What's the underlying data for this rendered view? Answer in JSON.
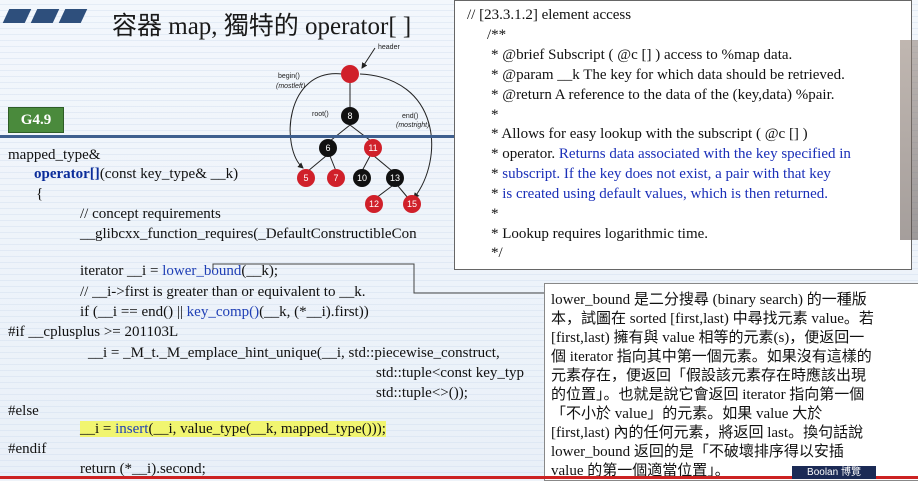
{
  "title": "容器 map, 獨特的 operator[ ]",
  "version_tag": "G4.9",
  "tree": {
    "header_label": "header",
    "begin_label": "begin()",
    "begin_sub": "(mostleft)",
    "root_label": "root()",
    "end_label": "end()",
    "end_sub": "(mostright)",
    "nodes": [
      "8",
      "6",
      "11",
      "5",
      "7",
      "10",
      "13",
      "12",
      "15"
    ]
  },
  "code": {
    "l1": "mapped_type&",
    "l2a": "operator[]",
    "l2b": "(const key_type& __k)",
    "l3": "{",
    "l4": "// concept requirements",
    "l5": "__glibcxx_function_requires(_DefaultConstructibleCon",
    "l6a": "iterator __i = ",
    "l6b": "lower_bound",
    "l6c": "(__k);",
    "l7": "// __i->first is greater than or equivalent to __k.",
    "l8a": "if (__i == end() || ",
    "l8b": "key_comp()",
    "l8c": "(__k, (*__i).first))",
    "l9": "#if __cplusplus >= 201103L",
    "l10": "__i = _M_t._M_emplace_hint_unique(__i, std::piecewise_construct,",
    "l11": "std::tuple<const key_typ",
    "l12": "std::tuple<>());",
    "l13": "#else",
    "l14a": "__i = ",
    "l14b": "insert",
    "l14c": "(__i, value_type(__k, mapped_type()));",
    "l15": "#endif",
    "l16": "return (*__i).second;"
  },
  "doc": {
    "d1": "// [23.3.1.2] element access",
    "d2": "/**",
    "d3": "*  @brief  Subscript ( @c [] ) access to %map data.",
    "d4": "*  @param  __k  The key for which data should be retrieved.",
    "d5": "*  @return  A reference to the data of the (key,data) %pair.",
    "d6": "*",
    "d7": "*  Allows for easy lookup with the subscript ( @c [] )",
    "d8a": "*  operator.  ",
    "d8b": "Returns data associated with the key specified in",
    "d9a": "*  ",
    "d9b": "subscript.  If the key does not exist, a pair with that key",
    "d10a": "*  ",
    "d10b": "is created using default values, which is then returned.",
    "d11": "*",
    "d12": "*  Lookup requires logarithmic time.",
    "d13": "*/"
  },
  "note": {
    "n1": "lower_bound 是二分搜尋 (binary search) 的一種版",
    "n2": "本，試圖在 sorted [first,last) 中尋找元素 value。若",
    "n3": "[first,last) 擁有與 value 相等的元素(s)，便返回一",
    "n4": "個 iterator 指向其中第一個元素。如果沒有這樣的",
    "n5": "元素存在，便返回「假設該元素存在時應該出現",
    "n6": "的位置」。也就是說它會返回 iterator 指向第一個",
    "n7": "「不小於 value」的元素。如果 value 大於",
    "n8": "[first,last) 內的任何元素，將返回 last。換句話說",
    "n9": "lower_bound 返回的是「不破壞排序得以安插",
    "n10": "value 的第一個適當位置」。"
  },
  "badge": "Boolan 博覽",
  "colors": {
    "keyword": "#0b2d9a",
    "highlight": "#f1f570",
    "tag": "#4a8a3c",
    "red_node": "#d0202a",
    "black_node": "#111111"
  }
}
